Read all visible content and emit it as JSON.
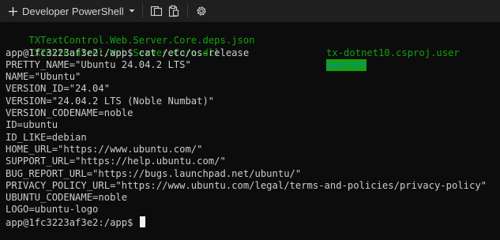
{
  "tabbar": {
    "new_tab_icon": "plus-icon",
    "profile_label": "Developer PowerShell",
    "dropdown_icon": "chevron-down-icon",
    "split_icon": "split-pane-icon",
    "clipboard_icon": "clipboard-icon",
    "settings_icon": "gear-icon",
    "accent_color": "#13a10e"
  },
  "terminal": {
    "file1": "TXTextControl.Web.Server.Core.deps.json",
    "file2": "tx-dotnet10.csproj.user",
    "file3": "TXTextControl.Web.Server.Core.dll",
    "file4": "wwwroot",
    "prompt1": "app@1fc3223af3e2:/app$ cat /etc/os-release",
    "lines": [
      "PRETTY_NAME=\"Ubuntu 24.04.2 LTS\"",
      "NAME=\"Ubuntu\"",
      "VERSION_ID=\"24.04\"",
      "VERSION=\"24.04.2 LTS (Noble Numbat)\"",
      "VERSION_CODENAME=noble",
      "ID=ubuntu",
      "ID_LIKE=debian",
      "HOME_URL=\"https://www.ubuntu.com/\"",
      "SUPPORT_URL=\"https://help.ubuntu.com/\"",
      "BUG_REPORT_URL=\"https://bugs.launchpad.net/ubuntu/\"",
      "PRIVACY_POLICY_URL=\"https://www.ubuntu.com/legal/terms-and-policies/privacy-policy\"",
      "UBUNTU_CODENAME=noble",
      "LOGO=ubuntu-logo"
    ],
    "prompt2": "app@1fc3223af3e2:/app$ ",
    "text_color": "#cccccc",
    "file_color": "#13a10e",
    "background": "#0c0c0c"
  }
}
